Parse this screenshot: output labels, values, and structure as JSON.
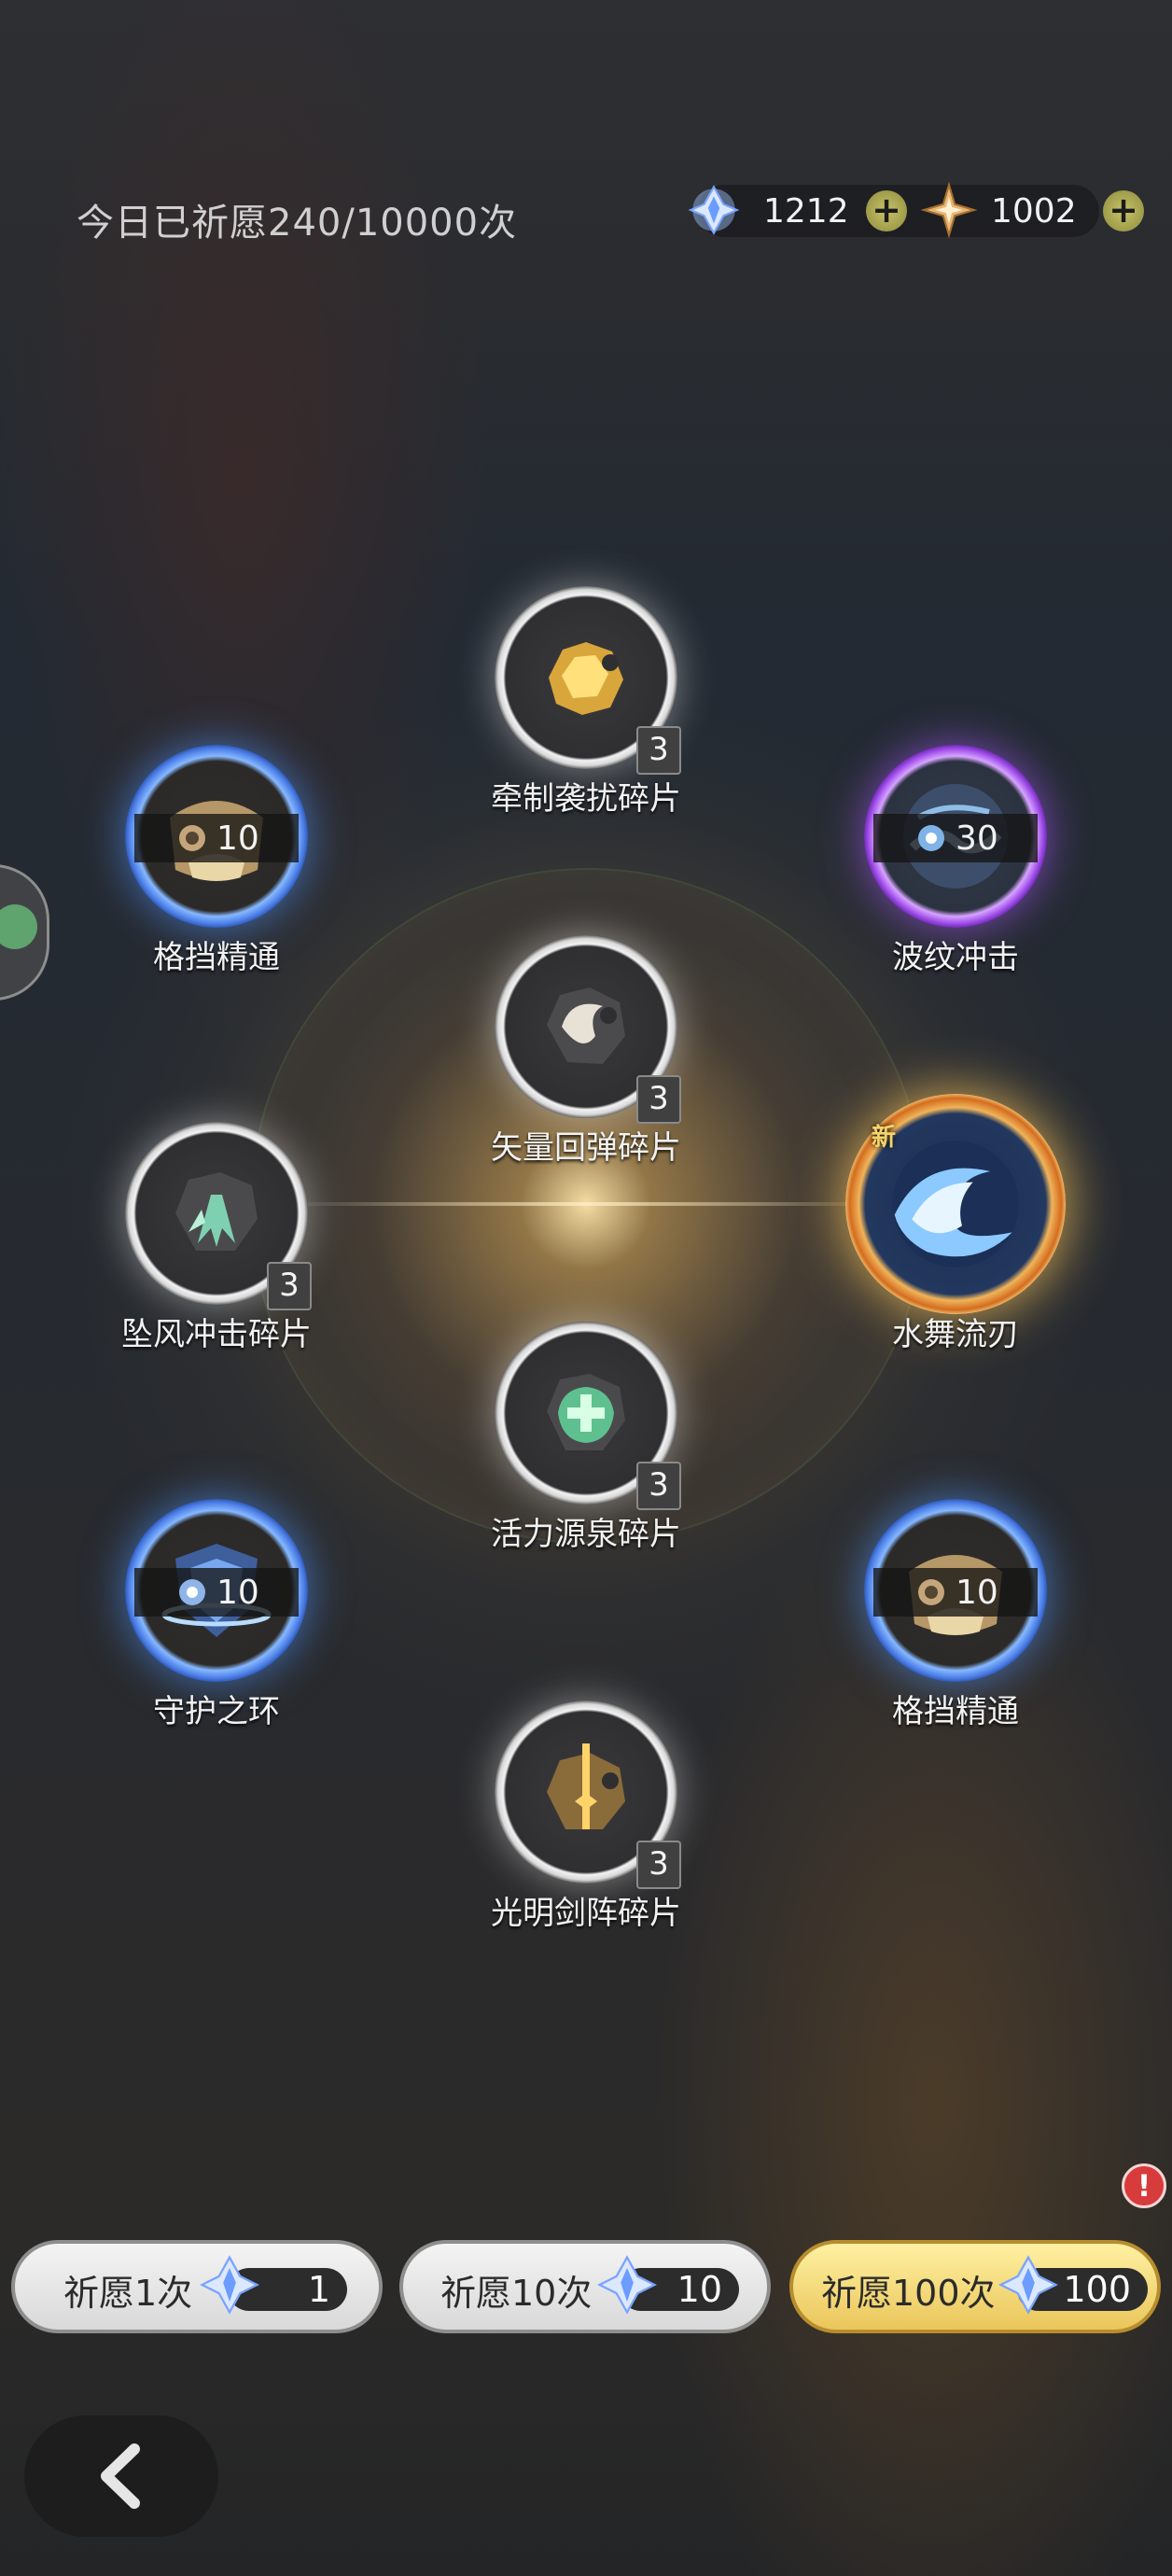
{
  "header": {
    "wish_status": "今日已祈愿240/10000次"
  },
  "currencies": [
    {
      "icon": "crystal-gem-icon",
      "amount": "1212"
    },
    {
      "icon": "star-shard-icon",
      "amount": "1002"
    }
  ],
  "rewards": {
    "top_center": {
      "name": "牵制袭扰碎片",
      "count": "3",
      "icon": "gold-fragment-icon"
    },
    "left_1": {
      "name": "格挡精通",
      "level": "10",
      "icon": "block-mastery-icon"
    },
    "right_1": {
      "name": "波纹冲击",
      "level": "30",
      "icon": "ripple-strike-icon"
    },
    "center_2": {
      "name": "矢量回弹碎片",
      "count": "3",
      "icon": "silver-fragment-icon"
    },
    "left_2": {
      "name": "坠风冲击碎片",
      "count": "3",
      "icon": "wind-fragment-icon"
    },
    "right_2": {
      "name": "水舞流刃",
      "badge": "新",
      "icon": "water-wave-icon"
    },
    "center_3": {
      "name": "活力源泉碎片",
      "count": "3",
      "icon": "green-cross-fragment-icon"
    },
    "left_3": {
      "name": "守护之环",
      "level": "10",
      "icon": "guard-ring-shield-icon"
    },
    "right_3": {
      "name": "格挡精通",
      "level": "10",
      "icon": "block-mastery-icon"
    },
    "bottom_center": {
      "name": "光明剑阵碎片",
      "count": "3",
      "icon": "sword-fragment-icon"
    }
  },
  "wish_buttons": [
    {
      "label": "祈愿1次",
      "cost": "1",
      "style": "grey"
    },
    {
      "label": "祈愿10次",
      "cost": "10",
      "style": "grey"
    },
    {
      "label": "祈愿100次",
      "cost": "100",
      "style": "gold"
    }
  ],
  "alert_badge": "!",
  "colors": {
    "white_ring": "#f2f2f2",
    "blue_ring": "#4a7ce6",
    "purple_ring": "#9a46e6",
    "gold_ring": "#d46d1f",
    "gold_button": "#eac65a"
  }
}
